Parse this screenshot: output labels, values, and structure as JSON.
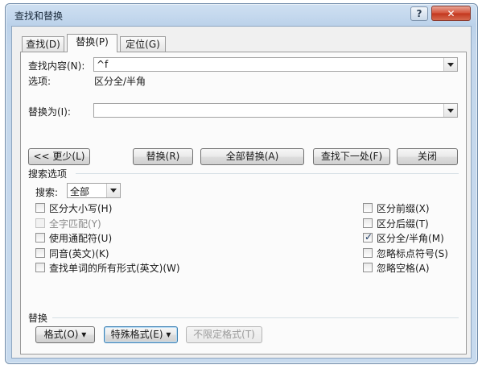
{
  "window": {
    "title": "查找和替换",
    "help_label": "?",
    "close_label": "✕"
  },
  "tabs": [
    {
      "label": "查找(D)"
    },
    {
      "label": "替换(P)"
    },
    {
      "label": "定位(G)"
    }
  ],
  "find": {
    "label": "查找内容(N):",
    "value": "^f"
  },
  "options_line": {
    "label": "选项:",
    "value": "区分全/半角"
  },
  "replace": {
    "label": "替换为(I):",
    "value": ""
  },
  "buttons": {
    "less": "<< 更少(L)",
    "replace": "替换(R)",
    "replace_all": "全部替换(A)",
    "find_next": "查找下一处(F)",
    "close": "关闭"
  },
  "search_options": {
    "heading": "搜索选项",
    "search_label": "搜索:",
    "search_value": "全部"
  },
  "checkboxes_left": [
    {
      "label": "区分大小写(H)",
      "checked": false,
      "disabled": false
    },
    {
      "label": "全字匹配(Y)",
      "checked": false,
      "disabled": true
    },
    {
      "label": "使用通配符(U)",
      "checked": false,
      "disabled": false
    },
    {
      "label": "同音(英文)(K)",
      "checked": false,
      "disabled": false
    },
    {
      "label": "查找单词的所有形式(英文)(W)",
      "checked": false,
      "disabled": false
    }
  ],
  "checkboxes_right": [
    {
      "label": "区分前缀(X)",
      "checked": false,
      "disabled": false
    },
    {
      "label": "区分后缀(T)",
      "checked": false,
      "disabled": false
    },
    {
      "label": "区分全/半角(M)",
      "checked": true,
      "disabled": false
    },
    {
      "label": "忽略标点符号(S)",
      "checked": false,
      "disabled": false
    },
    {
      "label": "忽略空格(A)",
      "checked": false,
      "disabled": false
    }
  ],
  "replace_section": {
    "heading": "替换",
    "format": "格式(O) ▾",
    "special": "特殊格式(E) ▾",
    "no_format": "不限定格式(T)"
  }
}
